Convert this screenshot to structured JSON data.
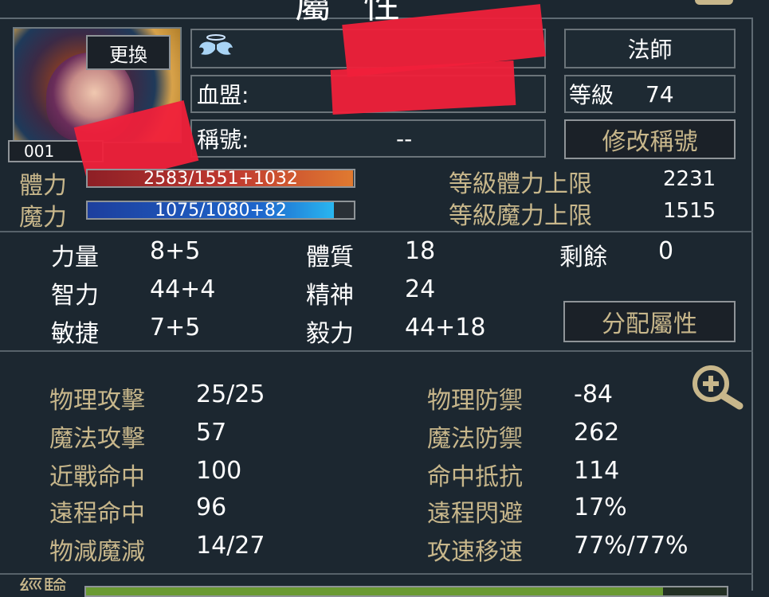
{
  "header": {
    "title_fragment": "屬性"
  },
  "profile": {
    "change_label": "更換",
    "id_partial": "001",
    "guild_label": "血盟:",
    "title_label": "稱號:",
    "title_value": "--",
    "class": "法師",
    "level_label": "等級",
    "level_value": "74",
    "edit_title_label": "修改稱號"
  },
  "vitals": {
    "hp_label": "體力",
    "hp_text": "2583/1551+1032",
    "hp_fraction": 0.997,
    "mp_label": "魔力",
    "mp_text": "1075/1080+82",
    "mp_fraction": 0.925,
    "hp_cap_label": "等級體力上限",
    "hp_cap_value": "2231",
    "mp_cap_label": "等級魔力上限",
    "mp_cap_value": "1515"
  },
  "attributes": {
    "items": [
      {
        "label": "力量",
        "value": "8+5"
      },
      {
        "label": "體質",
        "value": "18"
      },
      {
        "label": "剩餘",
        "value": "0"
      },
      {
        "label": "智力",
        "value": "44+4"
      },
      {
        "label": "精神",
        "value": "24"
      },
      {
        "label": "敏捷",
        "value": "7+5"
      },
      {
        "label": "毅力",
        "value": "44+18"
      }
    ],
    "allocate_label": "分配屬性"
  },
  "combat": {
    "left": [
      {
        "label": "物理攻擊",
        "value": "25/25"
      },
      {
        "label": "魔法攻擊",
        "value": "57"
      },
      {
        "label": "近戰命中",
        "value": "100"
      },
      {
        "label": "遠程命中",
        "value": "96"
      },
      {
        "label": "物減魔減",
        "value": "14/27"
      }
    ],
    "right": [
      {
        "label": "物理防禦",
        "value": "-84"
      },
      {
        "label": "魔法防禦",
        "value": "262"
      },
      {
        "label": "命中抵抗",
        "value": "114"
      },
      {
        "label": "遠程閃避",
        "value": "17%"
      },
      {
        "label": "攻速移速",
        "value": "77%/77%"
      }
    ]
  },
  "experience": {
    "label_fragment": "經驗",
    "fraction": 0.9
  },
  "colors": {
    "background": "#1c2730",
    "gold": "#c8b78b",
    "redaction": "#f0203a",
    "hp_fill": "#c03a30",
    "mp_fill": "#1e66cc"
  },
  "icons": {
    "wings": "angel-wings-icon",
    "zoom": "zoom-in-icon"
  }
}
